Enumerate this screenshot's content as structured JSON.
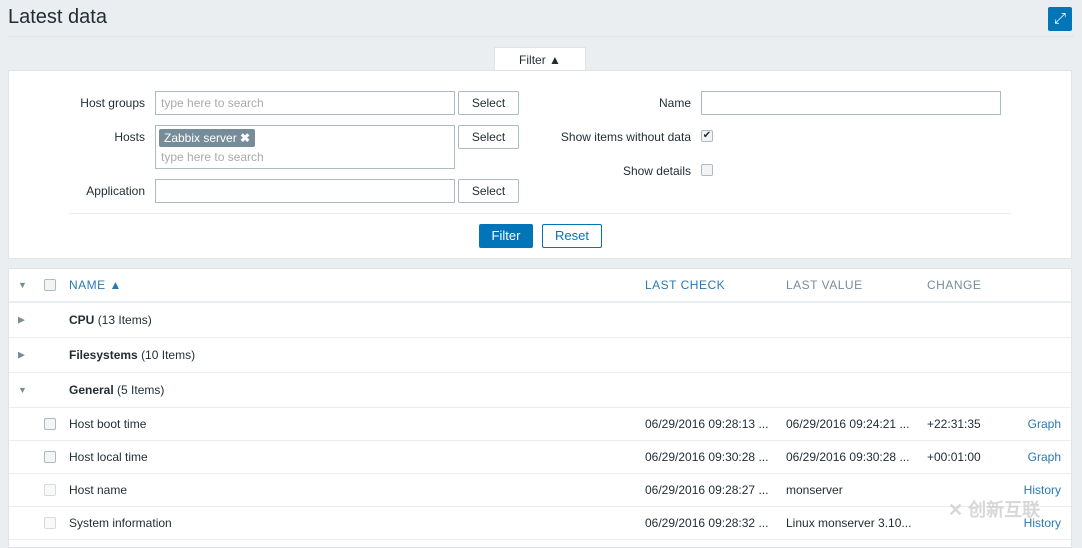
{
  "header": {
    "title": "Latest data",
    "fullscreen_icon": "fullscreen-icon"
  },
  "filter": {
    "tab_label": "Filter ▲",
    "host_groups": {
      "label": "Host groups",
      "placeholder": "type here to search",
      "select": "Select"
    },
    "hosts": {
      "label": "Hosts",
      "chip": "Zabbix server",
      "placeholder": "type here to search",
      "select": "Select"
    },
    "application": {
      "label": "Application",
      "value": "",
      "select": "Select"
    },
    "name": {
      "label": "Name",
      "value": ""
    },
    "show_without_data": {
      "label": "Show items without data",
      "checked": true
    },
    "show_details": {
      "label": "Show details",
      "checked": false
    },
    "filter_button": "Filter",
    "reset_button": "Reset"
  },
  "table": {
    "headers": {
      "name": "NAME ▲",
      "last_check": "LAST CHECK",
      "last_value": "LAST VALUE",
      "change": "CHANGE"
    },
    "groups": [
      {
        "name": "CPU",
        "count": "(13 Items)"
      },
      {
        "name": "Filesystems",
        "count": "(10 Items)"
      },
      {
        "name": "General",
        "count": "(5 Items)"
      }
    ],
    "items": [
      {
        "name": "Host boot time",
        "last_check": "06/29/2016 09:28:13 ...",
        "last_value": "06/29/2016 09:24:21 ...",
        "change": "+22:31:35",
        "link": "Graph"
      },
      {
        "name": "Host local time",
        "last_check": "06/29/2016 09:30:28 ...",
        "last_value": "06/29/2016 09:30:28 ...",
        "change": "+00:01:00",
        "link": "Graph"
      },
      {
        "name": "Host name",
        "last_check": "06/29/2016 09:28:27 ...",
        "last_value": "monserver",
        "change": "",
        "link": "History"
      },
      {
        "name": "System information",
        "last_check": "06/29/2016 09:28:32 ...",
        "last_value": "Linux monserver 3.10...",
        "change": "",
        "link": "History"
      }
    ]
  },
  "watermark": "创新互联"
}
